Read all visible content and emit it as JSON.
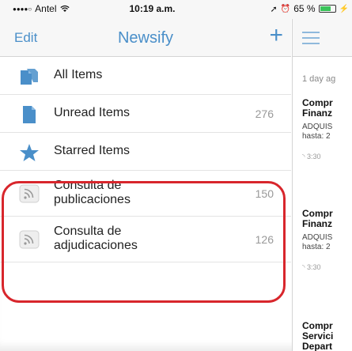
{
  "status_bar": {
    "carrier": "Antel",
    "time": "10:19 a.m.",
    "battery_percent_label": "65 %",
    "battery_level": 0.65
  },
  "nav": {
    "edit_label": "Edit",
    "title": "Newsify",
    "add_label": "+"
  },
  "feeds": [
    {
      "label": "All Items",
      "count": "",
      "icon": "documents-icon"
    },
    {
      "label": "Unread Items",
      "count": "276",
      "icon": "document-icon"
    },
    {
      "label": "Starred Items",
      "count": "",
      "icon": "star-icon"
    },
    {
      "label_line1": "Consulta de",
      "label_line2": "publicaciones",
      "count": "150",
      "icon": "rss-icon"
    },
    {
      "label_line1": "Consulta de",
      "label_line2": "adjudicaciones",
      "count": "126",
      "icon": "rss-icon"
    }
  ],
  "right_pane": {
    "date": "1 day ag",
    "article1_title1": "Compr",
    "article1_title2": "Finanz",
    "article1_body1": "ADQUIS",
    "article1_body2": "hasta: 2",
    "article1_time": "3:30",
    "article2_title1": "Compr",
    "article2_title2": "Finanz",
    "article2_body1": "ADQUIS",
    "article2_body2": "hasta: 2",
    "article2_time": "3:30",
    "article3_title1": "Compr",
    "article3_title2": "Servici",
    "article3_title3": "Depart"
  },
  "colors": {
    "accent": "#4a8fc9",
    "highlight": "#d8262c",
    "battery": "#3ac45a"
  }
}
